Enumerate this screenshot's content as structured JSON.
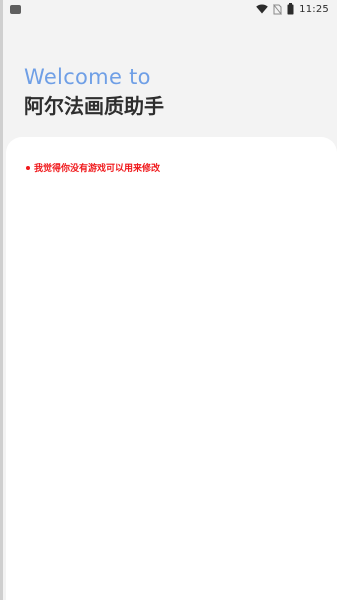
{
  "status_bar": {
    "time": "11:25",
    "icons": [
      "notification-icon",
      "wifi-icon",
      "no-sim-icon",
      "battery-icon"
    ]
  },
  "hero": {
    "welcome": "Welcome to",
    "app_name": "阿尔法画质助手"
  },
  "card": {
    "notice": "我觉得你没有游戏可以用来修改"
  },
  "colors": {
    "background": "#f3f3f3",
    "accent": "#6f9fe6",
    "title_text": "#2e2e2e",
    "card": "#ffffff",
    "notice_text": "#f0181b"
  }
}
